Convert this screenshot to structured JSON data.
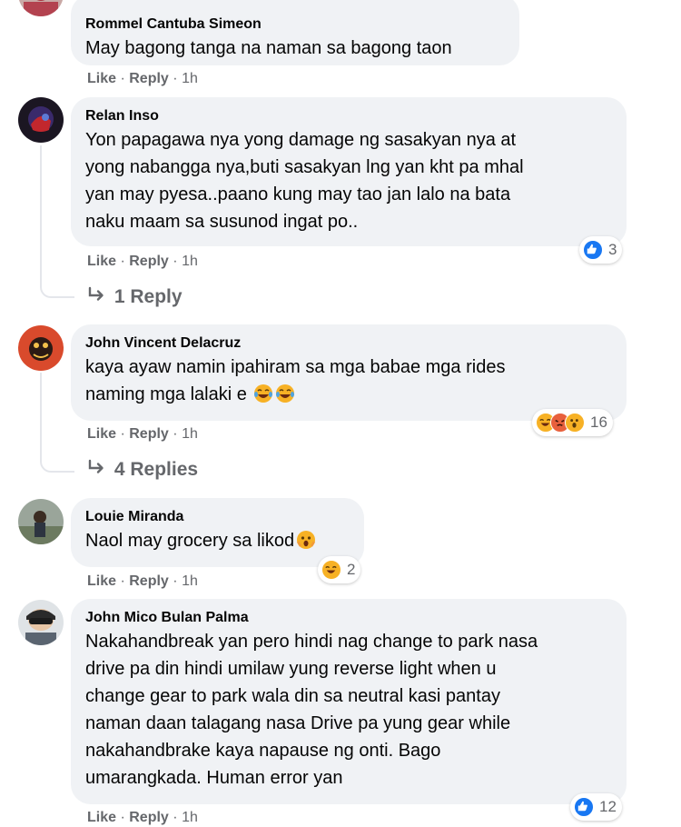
{
  "comments": [
    {
      "author": "Rommel Cantuba Simeon",
      "text": "May bagong tanga na naman sa bagong taon",
      "like_label": "Like",
      "reply_label": "Reply",
      "separator": "·",
      "time": "1h"
    },
    {
      "author": "Relan Inso",
      "lines": [
        "Yon papagawa nya yong damage ng sasakyan nya at",
        "yong nabangga nya,buti sasakyan lng yan kht pa mhal",
        "yan may pyesa..paano kung may tao jan lalo na bata",
        "naku maam sa susunod ingat po.."
      ],
      "like_label": "Like",
      "reply_label": "Reply",
      "separator": "·",
      "time": "1h",
      "reaction_count": "3",
      "reactions": [
        "like-icon"
      ],
      "replies_label": "1 Reply"
    },
    {
      "author": "John Vincent Delacruz",
      "lines": [
        "kaya ayaw namin ipahiram sa mga babae mga rides",
        "naming mga lalaki e"
      ],
      "inline_emojis": [
        "laughing-tears-emoji",
        "laughing-tears-emoji"
      ],
      "like_label": "Like",
      "reply_label": "Reply",
      "separator": "·",
      "time": "1h",
      "reaction_count": "16",
      "reactions": [
        "haha-icon",
        "angry-icon",
        "wow-icon"
      ],
      "replies_label": "4 Replies"
    },
    {
      "author": "Louie Miranda",
      "text": "Naol may grocery sa likod",
      "inline_emojis": [
        "astonished-face-emoji"
      ],
      "like_label": "Like",
      "reply_label": "Reply",
      "separator": "·",
      "time": "1h",
      "reaction_count": "2",
      "reactions": [
        "haha-icon"
      ]
    },
    {
      "author": "John Mico Bulan Palma",
      "lines": [
        "Nakahandbreak yan pero hindi nag change to park nasa",
        "drive pa din hindi umilaw yung reverse light when u",
        "change gear to park wala din sa neutral kasi pantay",
        "naman daan talagang nasa Drive pa yung gear while",
        "nakahandbrake kaya napause ng onti. Bago",
        "umarangkada. Human error yan"
      ],
      "like_label": "Like",
      "reply_label": "Reply",
      "separator": "·",
      "time": "1h",
      "reaction_count": "12",
      "reactions": [
        "like-icon"
      ]
    }
  ],
  "colors": {
    "bubble": "#f0f2f5",
    "secondary_text": "#65676b",
    "like_blue": "#1877f2",
    "haha_yellow": "#f7b125",
    "angry_orange": "#e8603c"
  }
}
